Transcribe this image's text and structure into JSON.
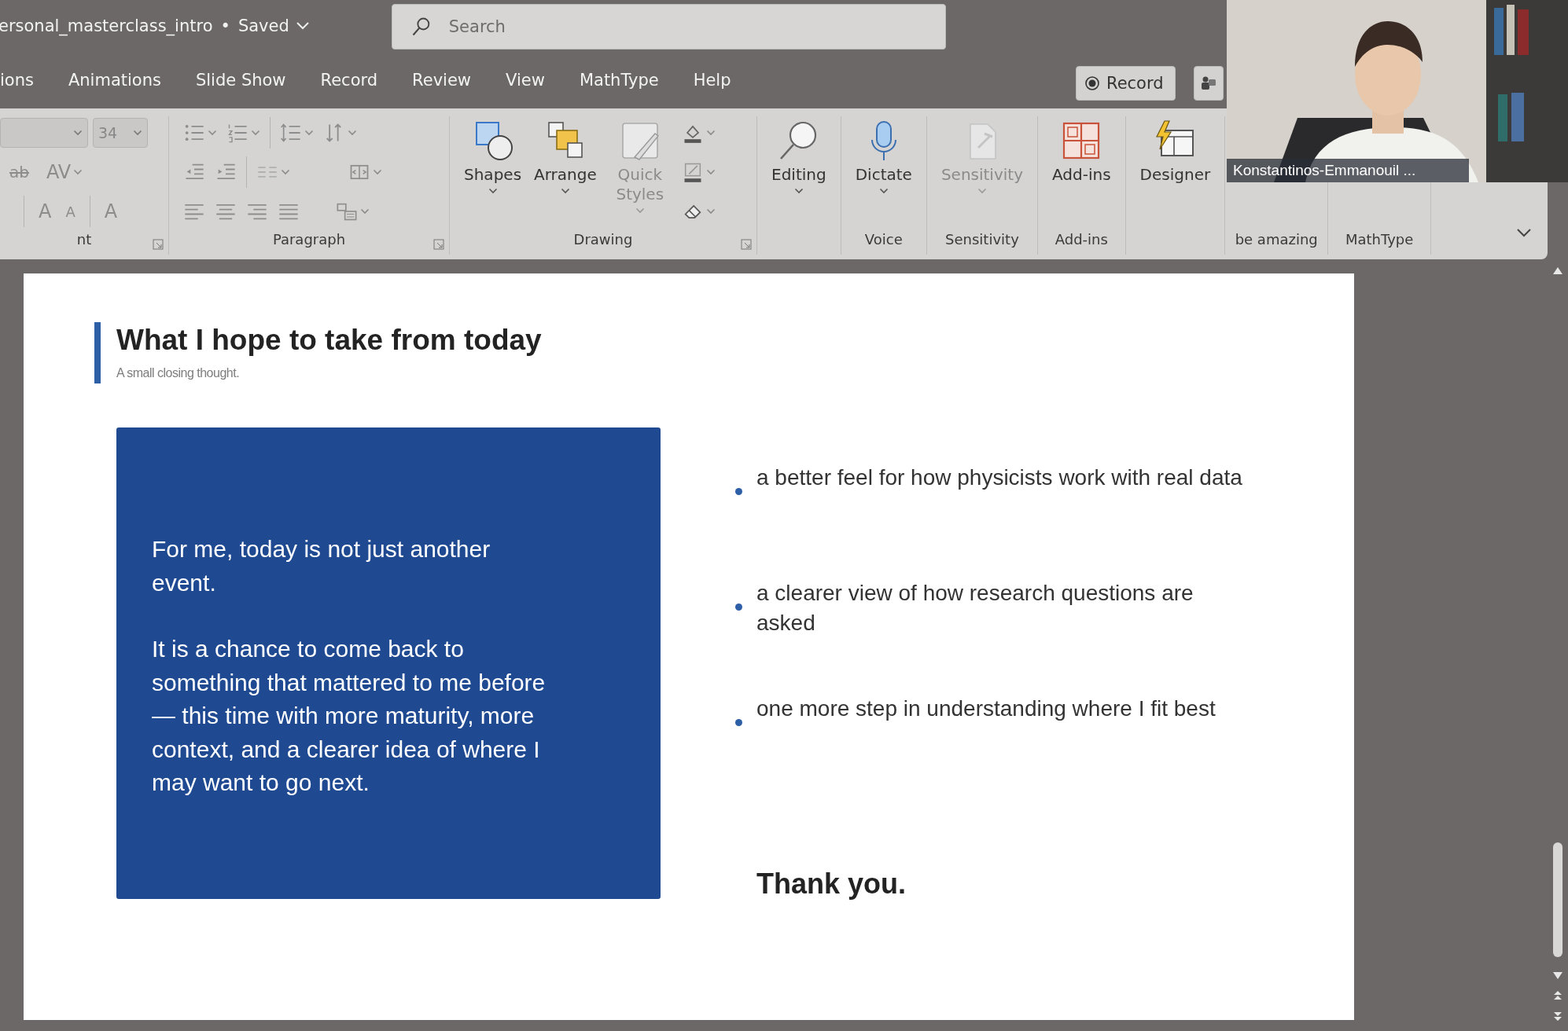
{
  "title_bar": {
    "file_name": "ersonal_masterclass_intro",
    "separator": "•",
    "status": "Saved"
  },
  "search": {
    "placeholder": "Search"
  },
  "tabs": [
    {
      "label": "ions"
    },
    {
      "label": "Animations"
    },
    {
      "label": "Slide Show"
    },
    {
      "label": "Record"
    },
    {
      "label": "Review"
    },
    {
      "label": "View"
    },
    {
      "label": "MathType"
    },
    {
      "label": "Help"
    }
  ],
  "record_button": {
    "label": "Record"
  },
  "ribbon": {
    "groups": [
      {
        "kind": "font",
        "label": "nt",
        "font_size": "34",
        "glyphs": [
          "ab",
          "AV",
          "A",
          "A",
          "A"
        ]
      },
      {
        "kind": "paragraph",
        "label": "Paragraph"
      },
      {
        "kind": "drawing",
        "label": "Drawing",
        "buttons": [
          {
            "kind": "shapes",
            "label": "Shapes",
            "disabled": false,
            "dropdown": true
          },
          {
            "kind": "arrange",
            "label": "Arrange",
            "disabled": false,
            "dropdown": true
          },
          {
            "kind": "quick-styles",
            "label": "Quick Styles",
            "disabled": true,
            "dropdown": true
          }
        ]
      },
      {
        "kind": "large",
        "buttons": [
          {
            "kind": "editing",
            "label": "Editing",
            "disabled": false,
            "dropdown": true
          }
        ]
      },
      {
        "kind": "large",
        "label": "Voice",
        "buttons": [
          {
            "kind": "dictate",
            "label": "Dictate",
            "disabled": false,
            "dropdown": true
          }
        ]
      },
      {
        "kind": "large",
        "label": "Sensitivity",
        "buttons": [
          {
            "kind": "sensitivity",
            "label": "Sensitivity",
            "disabled": true,
            "dropdown": true
          }
        ]
      },
      {
        "kind": "large",
        "label": "Add-ins",
        "buttons": [
          {
            "kind": "addins",
            "label": "Add-ins",
            "disabled": false,
            "dropdown": false
          }
        ]
      },
      {
        "kind": "large",
        "buttons": [
          {
            "kind": "designer",
            "label": "Designer",
            "disabled": false,
            "dropdown": false
          }
        ]
      },
      {
        "kind": "large",
        "label": "be amazing"
      },
      {
        "kind": "large",
        "label": "MathType"
      }
    ]
  },
  "webcam": {
    "kind": "picture",
    "name": "Konstantinos-Emmanouil ..."
  },
  "slide": {
    "title": "What I hope to take from today",
    "subtitle": "A small closing thought.",
    "card_paragraphs": [
      "For me, today is not just another event.",
      "It is a chance to come back to something that mattered to me before — this time with more maturity, more context, and a clearer idea of where I may want to go next."
    ],
    "bullets": [
      "a better feel for how physicists work with real data",
      "a clearer view of how research questions are asked",
      "one more step in understanding where I fit best"
    ],
    "closing": "Thank you."
  }
}
